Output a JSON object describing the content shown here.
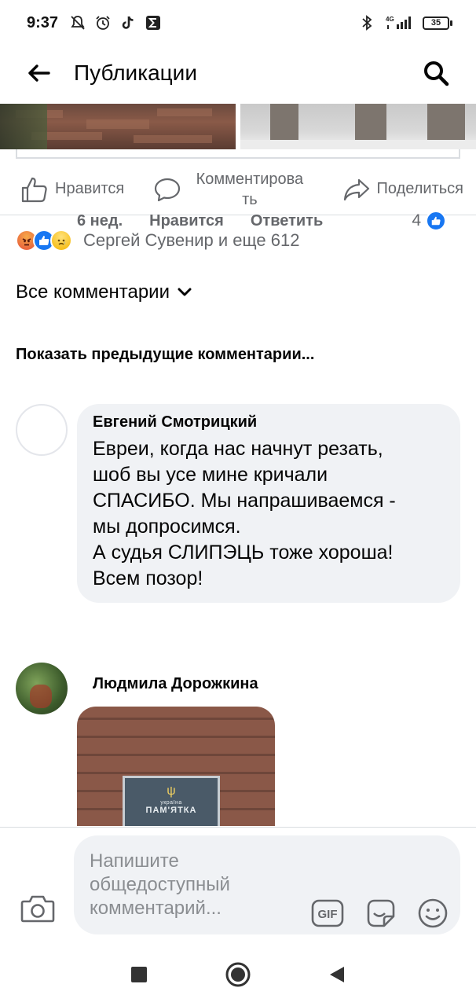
{
  "status_bar": {
    "time": "9:37",
    "network": "4G",
    "battery": "35",
    "icons": [
      "mute-icon",
      "alarm-icon",
      "tiktok-icon",
      "sigma-icon",
      "bluetooth-icon",
      "signal-icon",
      "battery-icon"
    ]
  },
  "header": {
    "title": "Публикации",
    "back_icon": "arrow-left-icon",
    "search_icon": "search-icon"
  },
  "post_actions": {
    "like_label": "Нравится",
    "comment_label": "Комментирова ть",
    "share_label": "Поделиться"
  },
  "reactions": {
    "types": [
      "angry",
      "like",
      "sad"
    ],
    "summary": "Сергей Сувенир и еще 612"
  },
  "comments_filter": {
    "label": "Все комментарии"
  },
  "previous_comments": {
    "label": "Показать предыдущие комментарии..."
  },
  "comments": [
    {
      "author": "Евгений Смотрицкий",
      "text": "Евреи, когда нас начнут резать,\nшоб вы усе мине кричали\nСПАСИБО. Мы напрашиваемся -\nмы допросимся.\nА судья СЛИПЭЦЬ тоже хороша!\nВсем позор!",
      "time": "6 нед.",
      "like_label": "Нравится",
      "reply_label": "Ответить",
      "reaction_count": "4"
    },
    {
      "author": "Людмила Дорожкина",
      "attachment": {
        "plaque_small": "україна",
        "plaque_big": "ПАМ'ЯТКА"
      }
    }
  ],
  "composer": {
    "placeholder": "Напишите общедоступный комментарий...",
    "icons": [
      "camera-icon",
      "gif-icon",
      "sticker-icon",
      "emoji-icon"
    ]
  },
  "nav_bar": {
    "icons": [
      "recents-icon",
      "home-icon",
      "back-icon"
    ]
  },
  "colors": {
    "accent": "#1877f2",
    "bubble": "#f0f2f5",
    "secondary_text": "#65676b"
  }
}
